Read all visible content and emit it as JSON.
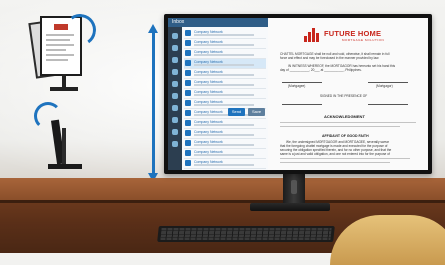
{
  "screen_app": {
    "topbar_title": "Inbox",
    "mail_rows": [
      {
        "name": "Company Network",
        "selected": false
      },
      {
        "name": "Company Network",
        "selected": false
      },
      {
        "name": "Company Network",
        "selected": false
      },
      {
        "name": "Company Network",
        "selected": true
      },
      {
        "name": "Company Network",
        "selected": false
      },
      {
        "name": "Company Network",
        "selected": false
      },
      {
        "name": "Company Network",
        "selected": false
      },
      {
        "name": "Company Network",
        "selected": false
      },
      {
        "name": "Company Network",
        "selected": false
      },
      {
        "name": "Company Network",
        "selected": false
      },
      {
        "name": "Company Network",
        "selected": false
      },
      {
        "name": "Company Network",
        "selected": false
      },
      {
        "name": "Company Network",
        "selected": false
      },
      {
        "name": "Company Network",
        "selected": false
      }
    ],
    "toolbar": {
      "reply_label": "Send",
      "forward_label": "Save"
    }
  },
  "document": {
    "brand": "FUTURE HOME",
    "brand_sub": "MORTGAGE SOLUTION",
    "intro_line": "CHATTEL MORTGAGE shall be null and void, otherwise, it shall remain in full",
    "intro_line2": "force and effect and may be foreclosed in the manner provided by law.",
    "witness": "IN WITNESS WHEREOF, the MORTGAGOR has hereunto set his hand this",
    "date_line": "day of ___________, 20___ at ___________, Philippines.",
    "mortgagee_label": "(Mortgagee)",
    "mortgagor_label": "(Mortgagor)",
    "signed_label": "SIGNED IN THE PRESENCE OF",
    "acknowledgment": "ACKNOWLEDGMENT",
    "affidavit": "AFFIDAVIT OF GOOD FAITH",
    "affidavit_text": "We, the undersigned MORTGAGOR and MORTGAGEE, severally swear",
    "affidavit_text2": "that the foregoing chattel mortgage is made and executed for the purpose of",
    "affidavit_text3": "securing the obligation specified therein, and for no other purpose, and that the",
    "affidavit_text4": "same is a just and valid obligation, and one not entered into for the purpose of"
  },
  "colors": {
    "accent": "#1e73be",
    "brand_red": "#c8261c",
    "app_bar": "#2f5d87"
  }
}
